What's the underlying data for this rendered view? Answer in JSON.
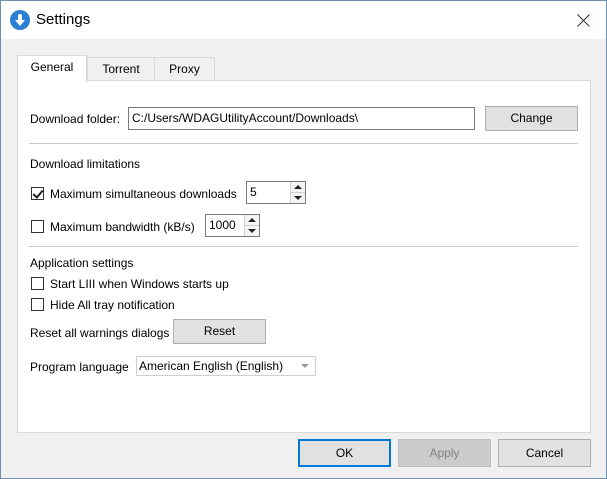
{
  "window": {
    "title": "Settings",
    "app_icon": "app-logo-icon",
    "close_icon": "close-icon"
  },
  "tabs": [
    {
      "label": "General",
      "active": true
    },
    {
      "label": "Torrent",
      "active": false
    },
    {
      "label": "Proxy",
      "active": false
    }
  ],
  "general": {
    "download_folder": {
      "label": "Download folder:",
      "value": "C:/Users/WDAGUtilityAccount/Downloads\\",
      "change_label": "Change"
    },
    "download_limitations": {
      "heading": "Download limitations",
      "max_downloads": {
        "label": "Maximum simultaneous downloads",
        "checked": true,
        "value": "5"
      },
      "max_bandwidth": {
        "label": "Maximum bandwidth (kB/s)",
        "checked": false,
        "value": "1000"
      }
    },
    "application_settings": {
      "heading": "Application settings",
      "start_on_boot": {
        "label": "Start LIII when Windows starts up",
        "checked": false
      },
      "hide_tray": {
        "label": "Hide All tray notification",
        "checked": false
      },
      "reset_warnings": {
        "label": "Reset all warnings dialogs",
        "button_label": "Reset"
      },
      "language": {
        "label": "Program language",
        "selected": "American English (English)"
      }
    }
  },
  "buttons": {
    "ok": "OK",
    "apply": "Apply",
    "cancel": "Cancel"
  }
}
